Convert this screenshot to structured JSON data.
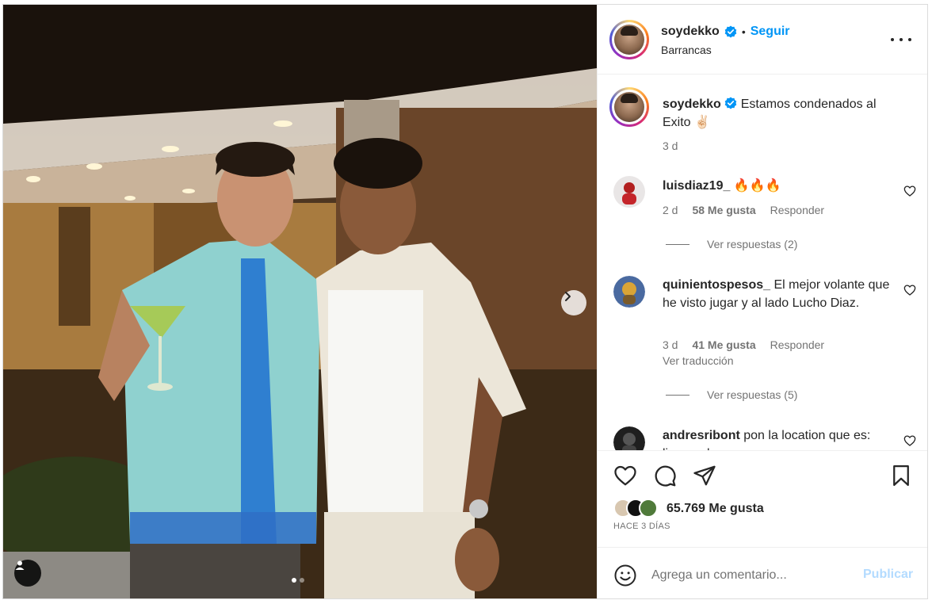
{
  "post": {
    "username": "soydekko",
    "verified": true,
    "separator": "•",
    "follow_label": "Seguir",
    "location": "Barrancas",
    "more_icon": "more-horizontal-icon",
    "carousel": {
      "current": 1,
      "total": 2
    }
  },
  "caption": {
    "username": "soydekko",
    "text": "Estamos condenados al Exito ✌🏻",
    "time": "3 d"
  },
  "comments": [
    {
      "username": "luisdiaz19_",
      "text": "🔥🔥🔥",
      "time": "2 d",
      "likes": "58 Me gusta",
      "reply_label": "Responder",
      "view_replies": "Ver respuestas (2)"
    },
    {
      "username": "quinientospesos_",
      "text": "El mejor volante que he visto jugar y al lado Lucho Diaz.",
      "time": "3 d",
      "likes": "41 Me gusta",
      "reply_label": "Responder",
      "translate_label": "Ver traducción",
      "view_replies": "Ver respuestas (5)"
    },
    {
      "username": "andresribont",
      "text": "pon la location que es: liverpool"
    }
  ],
  "actions": {
    "likes_count": "65.769 Me gusta",
    "time_ago": "HACE 3 DÍAS"
  },
  "add_comment": {
    "placeholder": "Agrega un comentario...",
    "post_label": "Publicar"
  },
  "colors": {
    "link": "#0095f6",
    "text": "#262626",
    "secondary": "#737373",
    "post_disabled": "#b3dbff"
  }
}
